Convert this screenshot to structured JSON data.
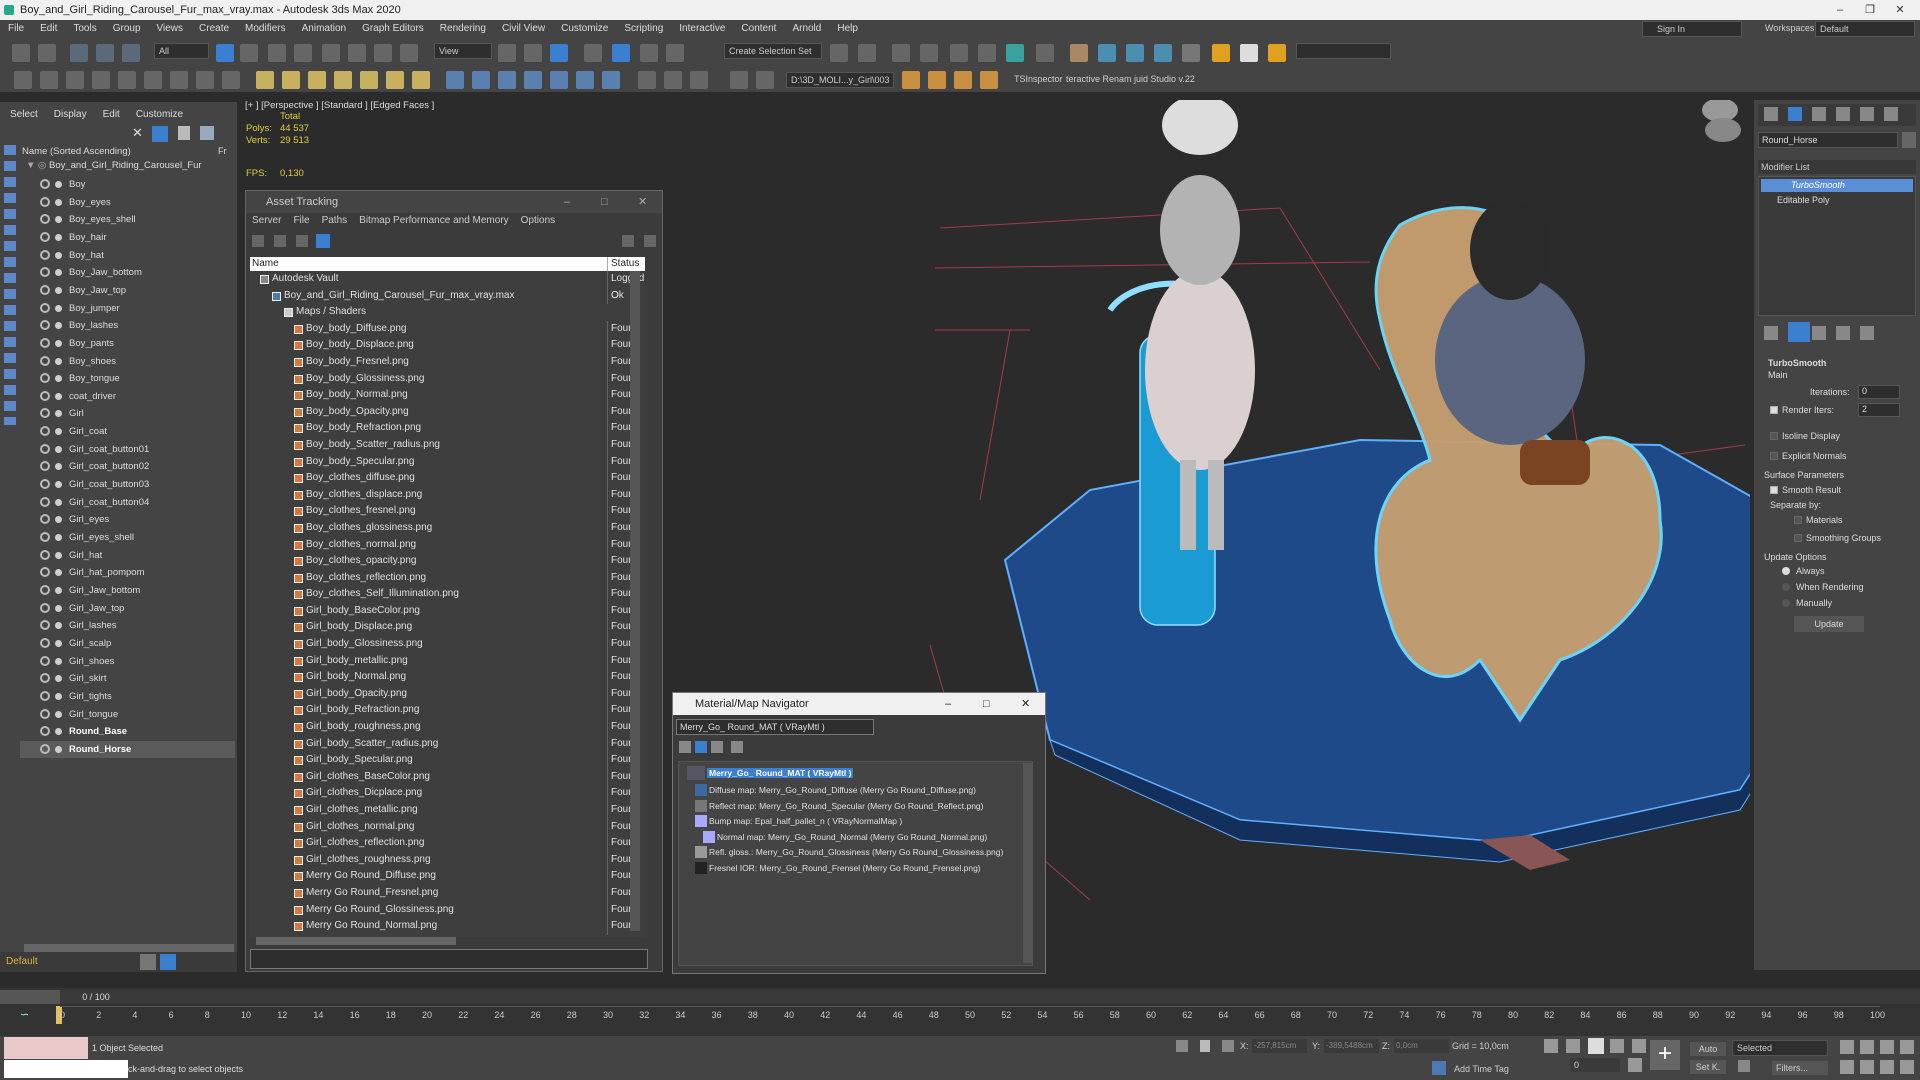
{
  "window": {
    "title": "Boy_and_Girl_Riding_Carousel_Fur_max_vray.max - Autodesk 3ds Max 2020"
  },
  "menu": [
    "File",
    "Edit",
    "Tools",
    "Group",
    "Views",
    "Create",
    "Modifiers",
    "Animation",
    "Graph Editors",
    "Rendering",
    "Civil View",
    "Customize",
    "Scripting",
    "Interactive",
    "Content",
    "Arnold",
    "Help"
  ],
  "signin": "Sign In",
  "workspaces": {
    "label": "Workspaces:",
    "value": "Default"
  },
  "toolbar": {
    "filter": "All",
    "view": "View",
    "selection_set": "Create Selection Set",
    "path": "D:\\3D_MOLI...y_Girl\\003",
    "tsinspector": "TSInspector",
    "renamer": "teractive Renam juid Studio v.22"
  },
  "scene_explorer": {
    "tabs": [
      "Select",
      "Display",
      "Edit",
      "Customize"
    ],
    "header": "Name (Sorted Ascending)",
    "header_right": "Fr",
    "root": "Boy_and_Girl_Riding_Carousel_Fur",
    "items": [
      "Boy",
      "Boy_eyes",
      "Boy_eyes_shell",
      "Boy_hair",
      "Boy_hat",
      "Boy_Jaw_bottom",
      "Boy_Jaw_top",
      "Boy_jumper",
      "Boy_lashes",
      "Boy_pants",
      "Boy_shoes",
      "Boy_tongue",
      "coat_driver",
      "Girl",
      "Girl_coat",
      "Girl_coat_button01",
      "Girl_coat_button02",
      "Girl_coat_button03",
      "Girl_coat_button04",
      "Girl_eyes",
      "Girl_eyes_shell",
      "Girl_hat",
      "Girl_hat_pompom",
      "Girl_Jaw_bottom",
      "Girl_Jaw_top",
      "Girl_lashes",
      "Girl_scalp",
      "Girl_shoes",
      "Girl_skirt",
      "Girl_tights",
      "Girl_tongue",
      "Round_Base",
      "Round_Horse"
    ],
    "layer": "Default"
  },
  "viewport": {
    "label": "[+ ] [Perspective ] [Standard ] [Edged Faces ]",
    "total": "Total",
    "polys_label": "Polys:",
    "polys": "44 537",
    "verts_label": "Verts:",
    "verts": "29 513",
    "fps_label": "FPS:",
    "fps": "0,130"
  },
  "asset_tracking": {
    "title": "Asset Tracking",
    "menu": [
      "Server",
      "File",
      "Paths",
      "Bitmap Performance and Memory",
      "Options"
    ],
    "col_name": "Name",
    "col_status": "Status",
    "vault": "Autodesk Vault",
    "vault_status": "Logged O",
    "file": "Boy_and_Girl_Riding_Carousel_Fur_max_vray.max",
    "file_status": "Ok",
    "maps": "Maps / Shaders",
    "found": "Found",
    "assets": [
      "Boy_body_Diffuse.png",
      "Boy_body_Displace.png",
      "Boy_body_Fresnel.png",
      "Boy_body_Glossiness.png",
      "Boy_body_Normal.png",
      "Boy_body_Opacity.png",
      "Boy_body_Refraction.png",
      "Boy_body_Scatter_radius.png",
      "Boy_body_Specular.png",
      "Boy_clothes_diffuse.png",
      "Boy_clothes_displace.png",
      "Boy_clothes_fresnel.png",
      "Boy_clothes_glossiness.png",
      "Boy_clothes_normal.png",
      "Boy_clothes_opacity.png",
      "Boy_clothes_reflection.png",
      "Boy_clothes_Self_Illumination.png",
      "Girl_body_BaseColor.png",
      "Girl_body_Displace.png",
      "Girl_body_Glossiness.png",
      "Girl_body_metallic.png",
      "Girl_body_Normal.png",
      "Girl_body_Opacity.png",
      "Girl_body_Refraction.png",
      "Girl_body_roughness.png",
      "Girl_body_Scatter_radius.png",
      "Girl_body_Specular.png",
      "Girl_clothes_BaseColor.png",
      "Girl_clothes_Dicplace.png",
      "Girl_clothes_metallic.png",
      "Girl_clothes_normal.png",
      "Girl_clothes_reflection.png",
      "Girl_clothes_roughness.png",
      "Merry Go Round_Diffuse.png",
      "Merry Go Round_Fresnel.png",
      "Merry Go Round_Glossiness.png",
      "Merry Go Round_Normal.png"
    ]
  },
  "material_navigator": {
    "title": "Material/Map Navigator",
    "current": "Merry_Go_ Round_MAT  ( VRayMtl )",
    "root": "Merry_Go_ Round_MAT  ( VRayMtl )",
    "maps": [
      "Diffuse map: Merry_Go_Round_Diffuse (Merry Go Round_Diffuse.png)",
      "Reflect map: Merry_Go_Round_Specular (Merry Go Round_Reflect.png)",
      "Bump map: Epal_half_pallet_n  ( VRayNormalMap )",
      "Normal map: Merry_Go_Round_Normal (Merry Go Round_Normal.png)",
      "Refl. gloss.: Merry_Go_Round_Glossiness (Merry Go Round_Glossiness.png)",
      "Fresnel IOR: Merry_Go_Round_Frensel (Merry Go Round_Frensel.png)"
    ]
  },
  "command_panel": {
    "object_name": "Round_Horse",
    "modifier_list": "Modifier List",
    "stack": [
      "TurboSmooth",
      "Editable Poly"
    ],
    "rollout": "TurboSmooth",
    "main": "Main",
    "iterations_label": "Iterations:",
    "iterations": "0",
    "render_iters_label": "Render Iters:",
    "render_iters": "2",
    "isoline": "Isoline Display",
    "explicit": "Explicit Normals",
    "surface": "Surface Parameters",
    "smooth_result": "Smooth Result",
    "separate": "Separate by:",
    "materials": "Materials",
    "smoothing": "Smoothing Groups",
    "update_options": "Update Options",
    "always": "Always",
    "when_rendering": "When Rendering",
    "manually": "Manually",
    "update": "Update"
  },
  "timeline": {
    "frame": "0 / 100",
    "ticks": [
      "0",
      "2",
      "4",
      "6",
      "8",
      "10",
      "12",
      "14",
      "16",
      "18",
      "20",
      "22",
      "24",
      "26",
      "28",
      "30",
      "32",
      "34",
      "36",
      "38",
      "40",
      "42",
      "44",
      "46",
      "48",
      "50",
      "52",
      "54",
      "56",
      "58",
      "60",
      "62",
      "64",
      "66",
      "68",
      "70",
      "72",
      "74",
      "76",
      "78",
      "80",
      "82",
      "84",
      "86",
      "88",
      "90",
      "92",
      "94",
      "96",
      "98",
      "100"
    ]
  },
  "status": {
    "selected": "1 Object Selected",
    "hint": "ck-and-drag to select objects",
    "x_label": "X:",
    "x": "-257,815cm",
    "y_label": "Y:",
    "y": "-389,5488cm",
    "z_label": "Z:",
    "z": "0,0cm",
    "grid": "Grid = 10,0cm",
    "add_time_tag": "Add Time Tag",
    "auto": "Auto",
    "setk": "Set K.",
    "selected_dd": "Selected",
    "filters": "Filters...",
    "frame_value": "0"
  }
}
